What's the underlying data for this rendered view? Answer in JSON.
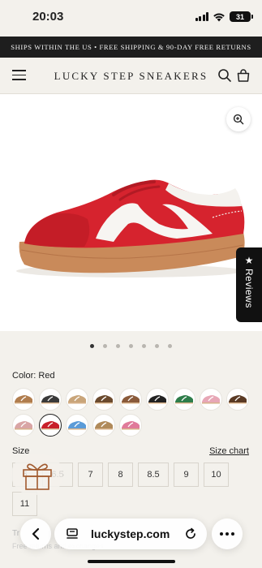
{
  "status": {
    "time": "20:03",
    "battery": "31"
  },
  "announcement": "SHIPS WITHIN THE US • FREE SHIPPING & 90-DAY FREE RETURNS",
  "header": {
    "logo": "LUCKY STEP SNEAKERS"
  },
  "gallery": {
    "image_count": 7,
    "active_index": 0
  },
  "reviews_tab": {
    "label": "Reviews"
  },
  "product": {
    "color_label": "Color: Red",
    "swatch_colors": [
      "#b07d4e",
      "#3a3a3a",
      "#c9a57a",
      "#6b4a2e",
      "#8a5a3a",
      "#222222",
      "#2e7d4a",
      "#e7a7b6",
      "#5a3a24",
      "#d9a5a5",
      "#c8202a",
      "#5a9bd8",
      "#b08a5a",
      "#e07a9a"
    ],
    "selected_swatch": 10,
    "size_label": "Size",
    "size_chart": "Size chart",
    "sizes": [
      "6",
      "6.5",
      "7",
      "8",
      "8.5",
      "9",
      "10",
      "11"
    ]
  },
  "faded": {
    "line1": "Tr",
    "line2": "Free returns and exchanges"
  },
  "browser": {
    "url": "luckystep.com"
  }
}
